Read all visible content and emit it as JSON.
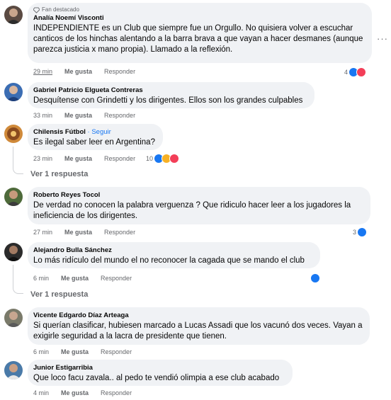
{
  "fan_label": "Fan destacado",
  "more_label": "···",
  "colors": {
    "like": "#1877f2",
    "love": "#f33e58",
    "haha": "#f7b125",
    "bubble": "#f0f2f5"
  },
  "comments": [
    {
      "author": "Analía Noemí Visconti",
      "text": "INDEPENDIENTE es un Club que siempre fue un Orgullo. No quisiera volver a escuchar canticos de los hinchas alentando a la barra brava a que vayan a hacer desmanes (aunque parezca justicia x mano propia). Llamado a la reflexión.",
      "time": "29 min",
      "like": "Me gusta",
      "reply": "Responder",
      "reaction_count": "4"
    },
    {
      "author": "Gabriel Patricio Elgueta Contreras",
      "text": "Desquítense con Grindetti y los dirigentes. Ellos son los grandes culpables",
      "time": "33 min",
      "like": "Me gusta",
      "reply": "Responder"
    },
    {
      "author": "Chilensis Fútbol",
      "follow": "· Seguir",
      "text": "Es ilegal saber leer en Argentina?",
      "time": "23 min",
      "like": "Me gusta",
      "reply": "Responder",
      "reaction_count": "10",
      "replies": "Ver 1 respuesta"
    },
    {
      "author": "Roberto Reyes Tocol",
      "text": "De verdad no conocen la palabra verguenza ? Que ridiculo hacer leer a los jugadores la ineficiencia de los dirigentes.",
      "time": "27 min",
      "like": "Me gusta",
      "reply": "Responder",
      "reaction_count": "3"
    },
    {
      "author": "Alejandro Bulla Sánchez",
      "text": "Lo más ridículo del mundo el no reconocer la cagada que se mando el club",
      "time": "6 min",
      "like": "Me gusta",
      "reply": "Responder",
      "replies": "Ver 1 respuesta"
    },
    {
      "author": "Vicente Edgardo Díaz Arteaga",
      "text": "Si querían clasificar, hubiesen marcado a Lucas Assadi que los vacunó dos veces. Vayan a exigirle seguridad a la lacra de presidente que tienen.",
      "time": "6 min",
      "like": "Me gusta",
      "reply": "Responder"
    },
    {
      "author": "Junior Estigarribia",
      "text": "Que loco facu zavala.. al pedo te vendió olimpia a ese club acabado",
      "time": "4 min",
      "like": "Me gusta",
      "reply": "Responder"
    }
  ]
}
